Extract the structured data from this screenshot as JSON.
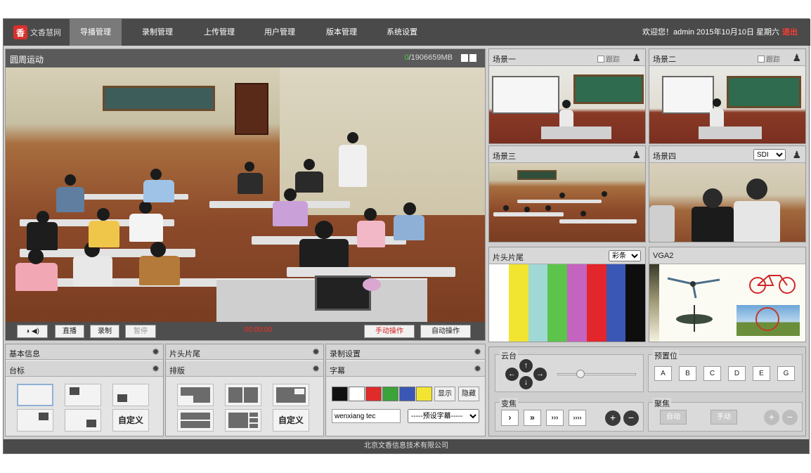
{
  "app": {
    "logo_text": "文香慧网",
    "logo_mark": "香"
  },
  "nav": {
    "items": [
      {
        "label": "导播管理",
        "active": true
      },
      {
        "label": "录制管理",
        "active": false
      },
      {
        "label": "上传管理",
        "active": false
      },
      {
        "label": "用户管理",
        "active": false
      },
      {
        "label": "版本管理",
        "active": false
      },
      {
        "label": "系统设置",
        "active": false
      }
    ],
    "welcome": "欢迎您！admin  2015年10月10日 星期六",
    "logout": "退出"
  },
  "main": {
    "title": "圆周运动",
    "storage_used": "0",
    "storage_total": "/1906659MB",
    "controls": {
      "live": "直播",
      "record": "录制",
      "pause": "暂停",
      "timer": "00:00:00",
      "manual": "手动操作",
      "auto": "自动操作",
      "audio_icon": "speaker-icon",
      "contrast_icon": "contrast-icon"
    }
  },
  "scenes": [
    {
      "title": "场景一",
      "track": "跟踪"
    },
    {
      "title": "场景二",
      "track": "跟踪"
    },
    {
      "title": "场景三"
    },
    {
      "title": "场景四",
      "select": "SDI"
    },
    {
      "title": "片头片尾",
      "select": "彩条"
    },
    {
      "title": "VGA2"
    }
  ],
  "colorbars": [
    "#ffffff",
    "#f2e531",
    "#9fd8d4",
    "#5cc44a",
    "#c563c0",
    "#e3262b",
    "#3a57b5",
    "#0e0e0e"
  ],
  "panels": {
    "basic_info": "基本信息",
    "station_logo": "台标",
    "intro_outro": "片头片尾",
    "layout": "排版",
    "record_settings": "录制设置",
    "subtitle": "字幕",
    "custom": "自定义"
  },
  "subtitle": {
    "colors": [
      "#111111",
      "#ffffff",
      "#e02b2b",
      "#3aa33a",
      "#3a57b5",
      "#f2e531"
    ],
    "show": "显示",
    "hide": "隐藏",
    "text_value": "wenxiang tec",
    "preset": "-----预设字幕-----"
  },
  "ptz": {
    "pan_tilt": "云台",
    "presets_label": "预置位",
    "presets": [
      "A",
      "B",
      "C",
      "D",
      "E",
      "G"
    ],
    "zoom_label": "变焦",
    "zoom_buttons": [
      "›",
      "»",
      "›››",
      "››››"
    ],
    "focus_label": "聚焦",
    "focus_auto": "自动",
    "focus_manual": "手动"
  },
  "footer": "北京文香信息技术有限公司"
}
